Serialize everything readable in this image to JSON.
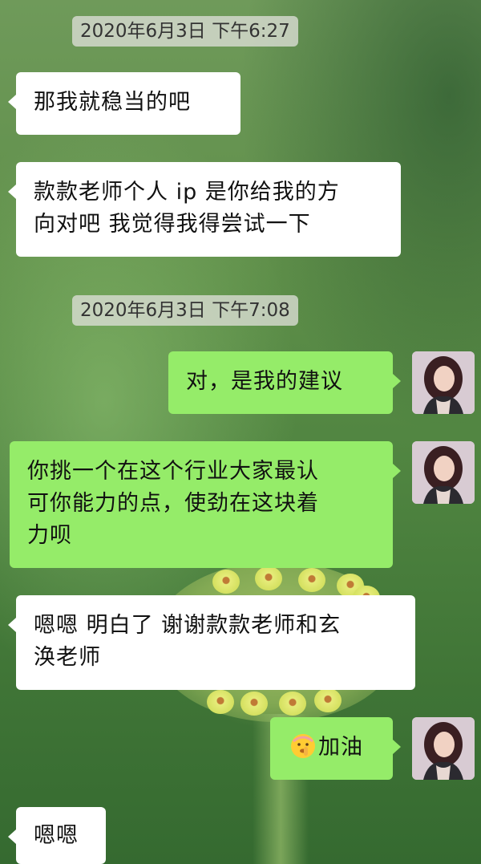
{
  "chat": {
    "timestamps": [
      "2020年6月3日 下午6:27",
      "2020年6月3日 下午7:08"
    ],
    "messages": [
      {
        "side": "incoming",
        "lines": [
          "那我就稳当的吧"
        ]
      },
      {
        "side": "incoming",
        "lines": [
          "款款老师个人 ip 是你给我的方",
          "向对吧 我觉得我得尝试一下"
        ]
      },
      {
        "side": "outgoing",
        "lines": [
          "对，是我的建议"
        ]
      },
      {
        "side": "outgoing",
        "lines": [
          "你挑一个在这个行业大家最认",
          "可你能力的点，使劲在这块着",
          "力呗"
        ]
      },
      {
        "side": "incoming",
        "lines": [
          "嗯嗯 明白了 谢谢款款老师和玄",
          "涣老师"
        ]
      },
      {
        "side": "outgoing",
        "emoji": "shushing-face-emoji",
        "lines": [
          "加油"
        ]
      },
      {
        "side": "incoming",
        "lines": [
          "嗯嗯"
        ]
      }
    ]
  },
  "colors": {
    "incoming_bubble": "#ffffff",
    "outgoing_bubble": "#95ec69",
    "timestamp_bg": "#e1e1dc"
  }
}
